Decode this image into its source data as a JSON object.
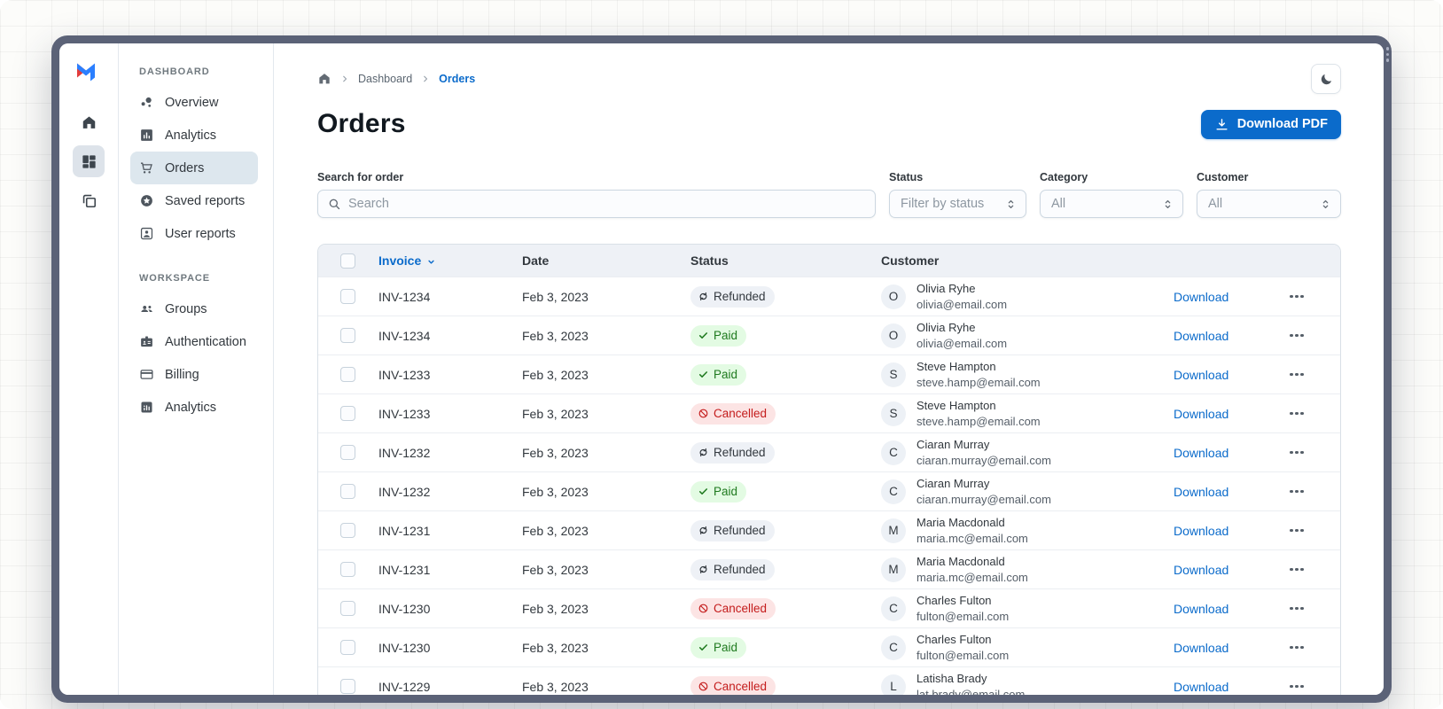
{
  "colors": {
    "accent": "#0b6bcb",
    "frame": "#5b6277",
    "paid_bg": "#e3fbe3",
    "paid_text": "#1f7a1f",
    "refunded_bg": "#eef1f6",
    "refunded_text": "#32383e",
    "cancelled_bg": "#fce4e4",
    "cancelled_text": "#c41c1c",
    "selected_nav_bg": "#dde7ee"
  },
  "rail": {
    "logo_icon": "mui-logo",
    "buttons": [
      {
        "icon": "home",
        "selected": false
      },
      {
        "icon": "apps",
        "selected": true
      },
      {
        "icon": "layers",
        "selected": false
      }
    ]
  },
  "sidebar": {
    "sections": [
      {
        "label": "DASHBOARD",
        "items": [
          {
            "icon": "bubbles",
            "label": "Overview",
            "selected": false
          },
          {
            "icon": "bar-chart",
            "label": "Analytics",
            "selected": false
          },
          {
            "icon": "cart",
            "label": "Orders",
            "selected": true
          },
          {
            "icon": "star-circle",
            "label": "Saved reports",
            "selected": false
          },
          {
            "icon": "person-card",
            "label": "User reports",
            "selected": false
          }
        ]
      },
      {
        "label": "WORKSPACE",
        "items": [
          {
            "icon": "groups",
            "label": "Groups",
            "selected": false
          },
          {
            "icon": "badge",
            "label": "Authentication",
            "selected": false
          },
          {
            "icon": "credit-card",
            "label": "Billing",
            "selected": false
          },
          {
            "icon": "chart-square",
            "label": "Analytics",
            "selected": false
          }
        ]
      }
    ]
  },
  "header": {
    "breadcrumb": {
      "items": [
        "Dashboard",
        "Orders"
      ]
    },
    "title": "Orders",
    "download_button": "Download PDF"
  },
  "filters": {
    "search": {
      "label": "Search for order",
      "placeholder": "Search"
    },
    "selects": [
      {
        "label": "Status",
        "value": "Filter by status",
        "width_class": "w-status"
      },
      {
        "label": "Category",
        "value": "All",
        "width_class": "w-cat"
      },
      {
        "label": "Customer",
        "value": "All",
        "width_class": "w-cust"
      }
    ]
  },
  "table": {
    "columns": [
      "Invoice",
      "Date",
      "Status",
      "Customer"
    ],
    "sorted_column": "Invoice",
    "download_label": "Download",
    "rows": [
      {
        "invoice": "INV-1234",
        "date": "Feb 3, 2023",
        "status": "Refunded",
        "avatar": "O",
        "name": "Olivia Ryhe",
        "email": "olivia@email.com"
      },
      {
        "invoice": "INV-1234",
        "date": "Feb 3, 2023",
        "status": "Paid",
        "avatar": "O",
        "name": "Olivia Ryhe",
        "email": "olivia@email.com"
      },
      {
        "invoice": "INV-1233",
        "date": "Feb 3, 2023",
        "status": "Paid",
        "avatar": "S",
        "name": "Steve Hampton",
        "email": "steve.hamp@email.com"
      },
      {
        "invoice": "INV-1233",
        "date": "Feb 3, 2023",
        "status": "Cancelled",
        "avatar": "S",
        "name": "Steve Hampton",
        "email": "steve.hamp@email.com"
      },
      {
        "invoice": "INV-1232",
        "date": "Feb 3, 2023",
        "status": "Refunded",
        "avatar": "C",
        "name": "Ciaran Murray",
        "email": "ciaran.murray@email.com"
      },
      {
        "invoice": "INV-1232",
        "date": "Feb 3, 2023",
        "status": "Paid",
        "avatar": "C",
        "name": "Ciaran Murray",
        "email": "ciaran.murray@email.com"
      },
      {
        "invoice": "INV-1231",
        "date": "Feb 3, 2023",
        "status": "Refunded",
        "avatar": "M",
        "name": "Maria Macdonald",
        "email": "maria.mc@email.com"
      },
      {
        "invoice": "INV-1231",
        "date": "Feb 3, 2023",
        "status": "Refunded",
        "avatar": "M",
        "name": "Maria Macdonald",
        "email": "maria.mc@email.com"
      },
      {
        "invoice": "INV-1230",
        "date": "Feb 3, 2023",
        "status": "Cancelled",
        "avatar": "C",
        "name": "Charles Fulton",
        "email": "fulton@email.com"
      },
      {
        "invoice": "INV-1230",
        "date": "Feb 3, 2023",
        "status": "Paid",
        "avatar": "C",
        "name": "Charles Fulton",
        "email": "fulton@email.com"
      },
      {
        "invoice": "INV-1229",
        "date": "Feb 3, 2023",
        "status": "Cancelled",
        "avatar": "L",
        "name": "Latisha Brady",
        "email": "lat.brady@email.com"
      }
    ]
  }
}
